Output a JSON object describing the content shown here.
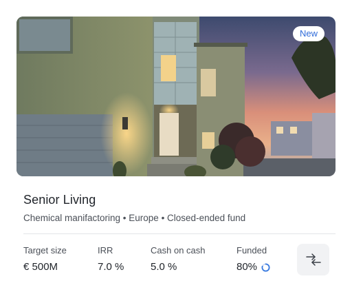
{
  "card": {
    "badge": "New",
    "title": "Senior Living",
    "subtitle": "Chemical manifactoring • Europe • Closed-ended fund",
    "stats": [
      {
        "label": "Target size",
        "value": "€ 500M"
      },
      {
        "label": "IRR",
        "value": "7.0 %"
      },
      {
        "label": "Cash on cash",
        "value": "5.0 %"
      },
      {
        "label": "Funded",
        "value": "80%",
        "progress": 0.8
      }
    ],
    "compare_icon": "compare-arrows-icon",
    "colors": {
      "badge_text": "#2f6bd9",
      "progress_ring": "#3a7be0",
      "button_bg": "#f1f2f4"
    }
  }
}
